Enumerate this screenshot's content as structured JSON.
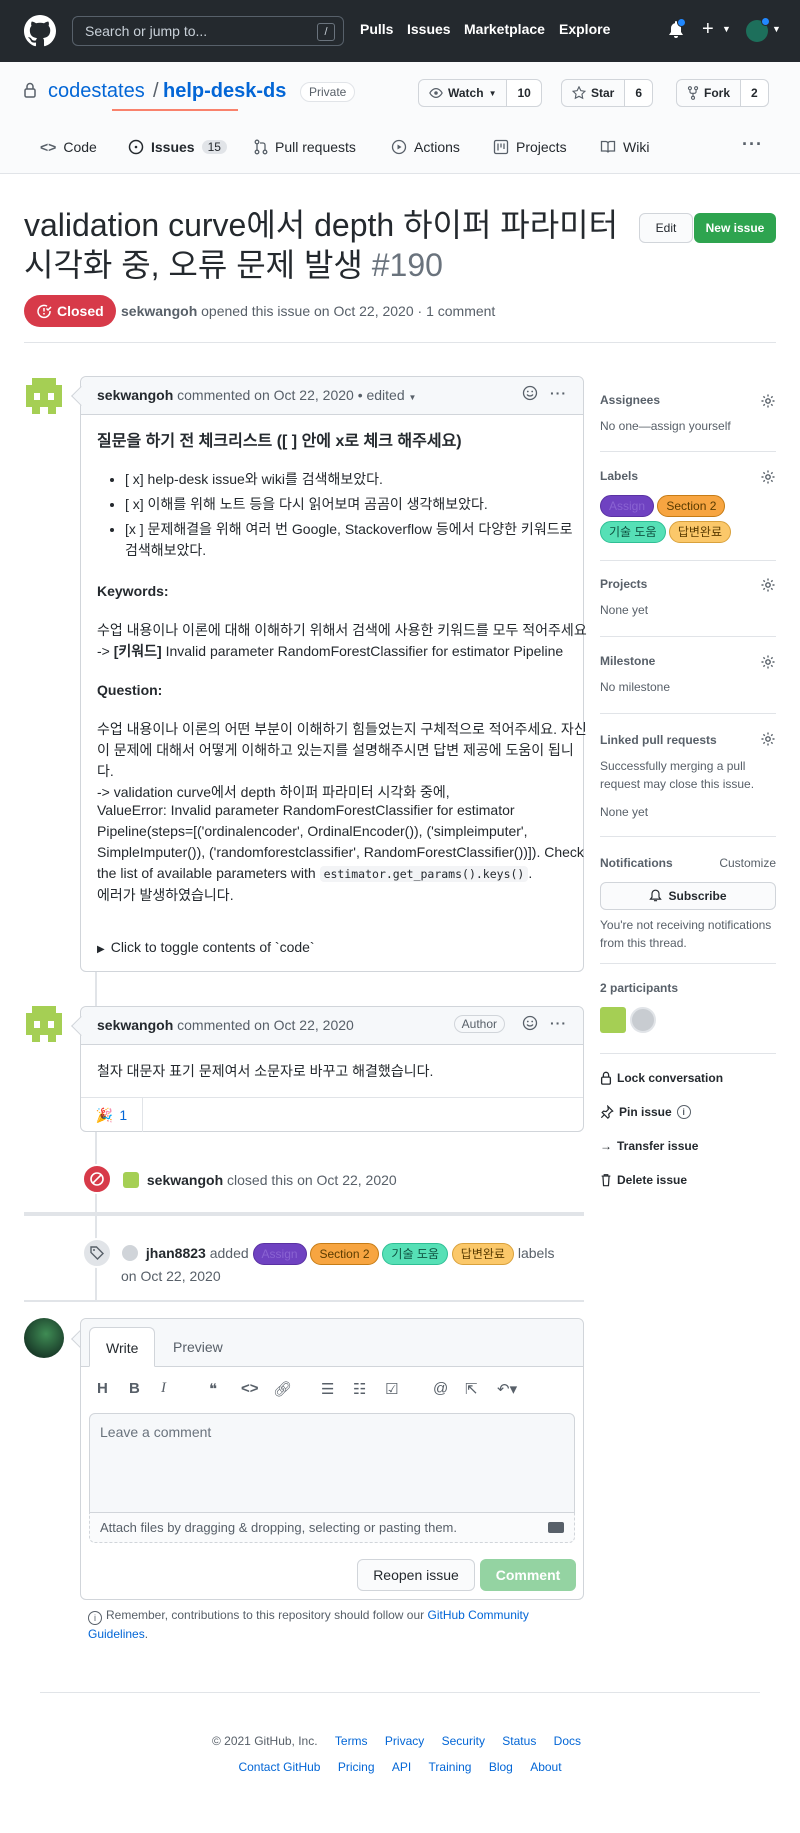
{
  "header": {
    "search_placeholder": "Search or jump to...",
    "search_shortcut": "/",
    "nav": [
      "Pulls",
      "Issues",
      "Marketplace",
      "Explore"
    ]
  },
  "repo": {
    "owner": "codestates",
    "slash": "/",
    "name": "help-desk-ds",
    "visibility": "Private",
    "watch_label": "Watch",
    "watch_count": "10",
    "star_label": "Star",
    "star_count": "6",
    "fork_label": "Fork",
    "fork_count": "2"
  },
  "tabs": {
    "code": "Code",
    "issues": "Issues",
    "issues_count": "15",
    "pulls": "Pull requests",
    "actions": "Actions",
    "projects": "Projects",
    "wiki": "Wiki"
  },
  "issue": {
    "title": "validation curve에서 depth 하이퍼 파라미터 시각화 중, 오류 문제 발생",
    "number": "#190",
    "edit_label": "Edit",
    "new_issue_label": "New issue",
    "state": "Closed",
    "author": "sekwangoh",
    "meta": "opened this issue on Oct 22, 2020 · 1 comment"
  },
  "first_comment": {
    "author": "sekwangoh",
    "meta": "commented on Oct 22, 2020 • edited",
    "heading": "질문을 하기 전 체크리스트 ([ ] 안에 x로 체크 해주세요)",
    "checklist": [
      "[ x] help-desk issue와 wiki를 검색해보았다.",
      "[ x] 이해를 위해 노트 등을 다시 읽어보며 곰곰이 생각해보았다.",
      "[x ] 문제해결을 위해 여러 번 Google, Stackoverflow 등에서 다양한 키워드로 검색해보았다."
    ],
    "keywords_heading": "Keywords:",
    "keywords_line1": "수업 내용이나 이론에 대해 이해하기 위해서 검색에 사용한 키워드를 모두 적어주세요",
    "keywords_prefix": "-> ",
    "keywords_bold": "[키워드]",
    "keywords_rest": " Invalid parameter RandomForestClassifier for estimator Pipeline",
    "question_heading": "Question:",
    "question_line1": "수업 내용이나 이론의 어떤 부분이 이해하기 힘들었는지 구체적으로 적어주세요. 자신이 문제에 대해서 어떻게 이해하고 있는지를 설명해주시면 답변 제공에 도움이 됩니다.",
    "question_line2": "-> validation curve에서 depth 하이퍼 파라미터 시각화 중에,",
    "error_text": "ValueError: Invalid parameter RandomForestClassifier for estimator Pipeline(steps=[('ordinalencoder', OrdinalEncoder()), ('simpleimputer', SimpleImputer()), ('randomforestclassifier', RandomForestClassifier())]). Check the list of available parameters with ",
    "error_code": "estimator.get_params().keys()",
    "error_end": ".",
    "error_line2": "에러가 발생하였습니다.",
    "toggle": "Click to toggle contents of `code`"
  },
  "second_comment": {
    "author": "sekwangoh",
    "meta": "commented on Oct 22, 2020",
    "badge": "Author",
    "body": "철자 대문자 표기 문제여서 소문자로 바꾸고 해결했습니다.",
    "reaction_emoji": "🎉",
    "reaction_count": "1"
  },
  "closed_event": {
    "actor": "sekwangoh",
    "text": "closed this on Oct 22, 2020"
  },
  "label_event": {
    "actor": "jhan8823",
    "verb": "added",
    "suffix": "labels",
    "date": "on Oct 22, 2020"
  },
  "labels": {
    "assign": "Assign",
    "section2": "Section 2",
    "tech": "기술 도움",
    "done": "답변완료"
  },
  "editor": {
    "write_tab": "Write",
    "preview_tab": "Preview",
    "placeholder": "Leave a comment",
    "attach_hint": "Attach files by dragging & dropping, selecting or pasting them.",
    "reopen_label": "Reopen issue",
    "comment_label": "Comment",
    "remember_text": "Remember, contributions to this repository should follow our ",
    "remember_link": "GitHub Community Guidelines",
    "remember_end": "."
  },
  "sidebar": {
    "assignees_title": "Assignees",
    "assignees_value": "No one—assign yourself",
    "labels_title": "Labels",
    "projects_title": "Projects",
    "projects_value": "None yet",
    "milestone_title": "Milestone",
    "milestone_value": "No milestone",
    "linked_title": "Linked pull requests",
    "linked_desc": "Successfully merging a pull request may close this issue.",
    "linked_value": "None yet",
    "notifications_title": "Notifications",
    "customize": "Customize",
    "subscribe_label": "Subscribe",
    "notifications_desc": "You're not receiving notifications from this thread.",
    "participants_title": "2 participants",
    "lock": "Lock conversation",
    "pin": "Pin issue",
    "transfer": "Transfer issue",
    "delete": "Delete issue"
  },
  "footer": {
    "copyright": "© 2021 GitHub, Inc.",
    "row1": [
      "Terms",
      "Privacy",
      "Security",
      "Status",
      "Docs"
    ],
    "row2": [
      "Contact GitHub",
      "Pricing",
      "API",
      "Training",
      "Blog",
      "About"
    ]
  },
  "colors": {
    "closed_red": "#d73a49",
    "green": "#2ea44f",
    "link_blue": "#0366d6",
    "header_dark": "#24292e"
  }
}
